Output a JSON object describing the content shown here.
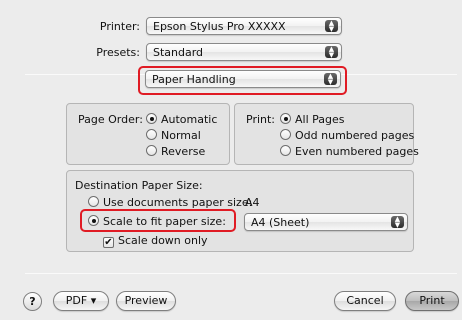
{
  "printer": {
    "label": "Printer:",
    "value": "Epson Stylus Pro XXXXX"
  },
  "presets": {
    "label": "Presets:",
    "value": "Standard"
  },
  "panel": {
    "value": "Paper Handling"
  },
  "page_order": {
    "label": "Page Order:",
    "options": [
      "Automatic",
      "Normal",
      "Reverse"
    ],
    "selected": "Automatic"
  },
  "print": {
    "label": "Print:",
    "options": [
      "All Pages",
      "Odd numbered pages",
      "Even numbered pages"
    ],
    "selected": "All Pages"
  },
  "destination": {
    "title": "Destination Paper Size:",
    "use_documents_label": "Use documents paper size:",
    "use_documents_value": "A4",
    "scale_to_fit_label": "Scale to fit paper size:",
    "scale_to_fit_value": "A4 (Sheet)",
    "scale_down_label": "Scale down only",
    "scale_down_checked": true,
    "selected": "scale_to_fit"
  },
  "footer": {
    "help_label": "?",
    "pdf_label": "PDF ▾",
    "preview_label": "Preview",
    "cancel_label": "Cancel",
    "print_label": "Print"
  },
  "colors": {
    "highlight": "#e01b24",
    "window_bg": "#ececec"
  }
}
